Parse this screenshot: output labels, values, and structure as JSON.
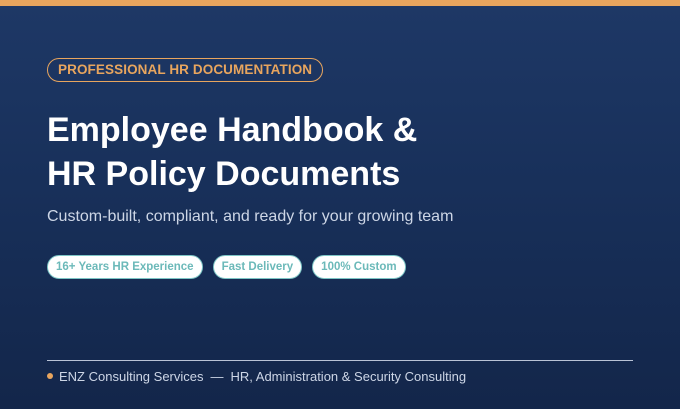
{
  "banner": {
    "eyebrow": "PROFESSIONAL HR DOCUMENTATION",
    "headline_line1": "Employee Handbook &",
    "headline_line2": "HR Policy Documents",
    "subtitle": "Custom-built, compliant, and ready for your growing team",
    "tags": [
      "16+ Years HR Experience",
      "Fast Delivery",
      "100% Custom"
    ],
    "footer": {
      "company": "ENZ Consulting Services",
      "separator": "—",
      "tagline": "HR, Administration & Security Consulting"
    }
  },
  "colors": {
    "background_top": "#1e3866",
    "background_bottom": "#13264a",
    "accent_orange": "#e8a55e",
    "tag_teal": "#6bb9b9",
    "headline_white": "#ffffff",
    "muted_text": "#cdd6e6"
  },
  "icons": {
    "footer_bullet": "orange-dot-icon"
  }
}
